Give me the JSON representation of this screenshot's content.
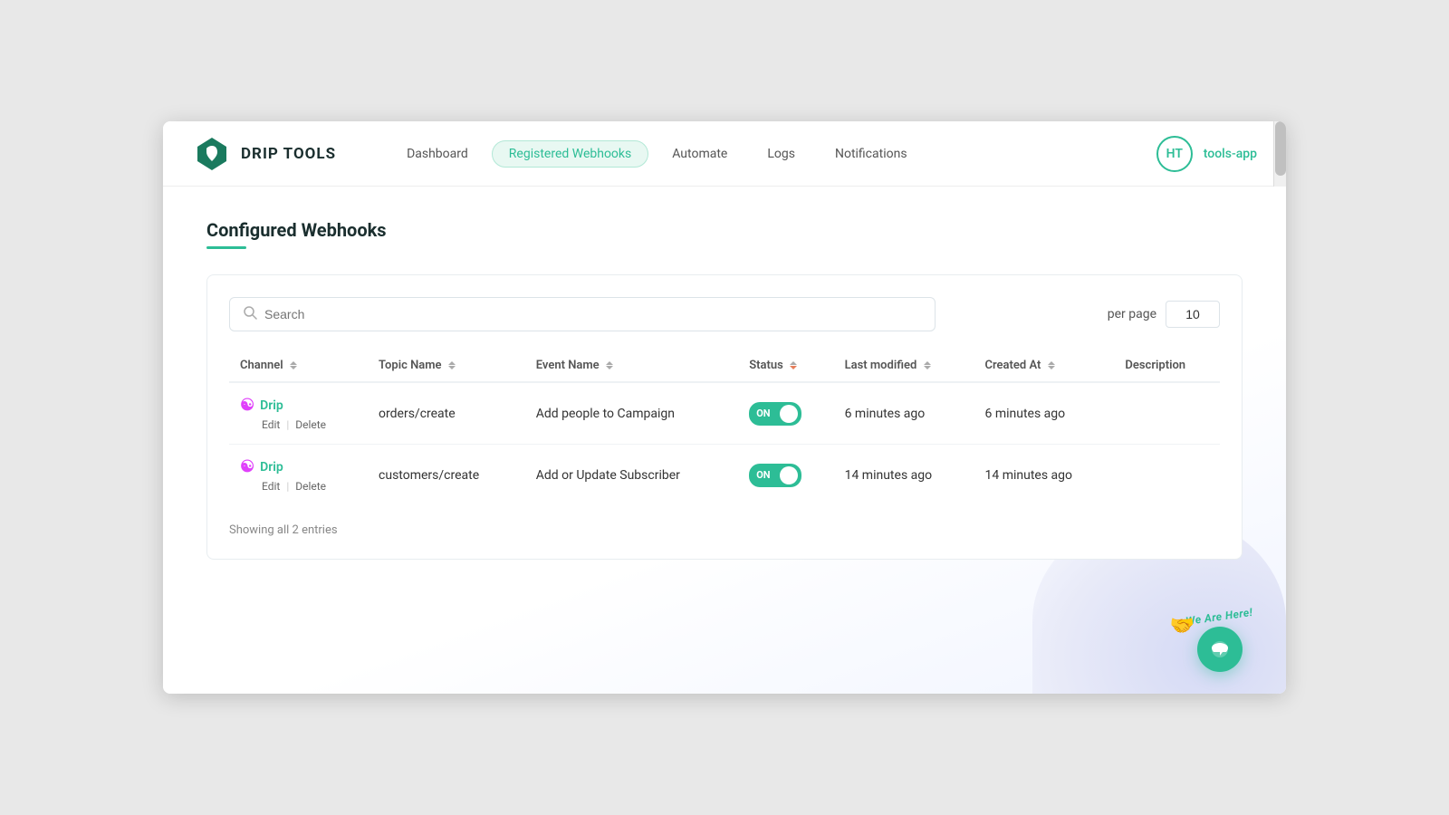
{
  "app": {
    "title": "DRIP TOOLS",
    "user_initials": "HT",
    "user_app": "tools-app"
  },
  "navbar": {
    "links": [
      {
        "label": "Dashboard",
        "active": false
      },
      {
        "label": "Registered Webhooks",
        "active": true
      },
      {
        "label": "Automate",
        "active": false
      },
      {
        "label": "Logs",
        "active": false
      },
      {
        "label": "Notifications",
        "active": false
      }
    ]
  },
  "page": {
    "title": "Configured Webhooks"
  },
  "table": {
    "search_placeholder": "Search",
    "per_page_label": "per page",
    "per_page_value": "10",
    "columns": [
      {
        "label": "Channel",
        "sortable": true
      },
      {
        "label": "Topic Name",
        "sortable": true
      },
      {
        "label": "Event Name",
        "sortable": true
      },
      {
        "label": "Status",
        "sortable": true,
        "status": true
      },
      {
        "label": "Last modified",
        "sortable": true
      },
      {
        "label": "Created At",
        "sortable": true
      },
      {
        "label": "Description",
        "sortable": false
      }
    ],
    "rows": [
      {
        "channel": "Drip",
        "topic": "orders/create",
        "event": "Add people to Campaign",
        "status": "ON",
        "last_modified": "6 minutes ago",
        "created_at": "6 minutes ago",
        "description": ""
      },
      {
        "channel": "Drip",
        "topic": "customers/create",
        "event": "Add or Update Subscriber",
        "status": "ON",
        "last_modified": "14 minutes ago",
        "created_at": "14 minutes ago",
        "description": ""
      }
    ],
    "showing": "Showing all 2 entries",
    "edit_label": "Edit",
    "delete_label": "Delete"
  },
  "chat": {
    "label": "We Are Here!",
    "emoji": "🤝"
  }
}
